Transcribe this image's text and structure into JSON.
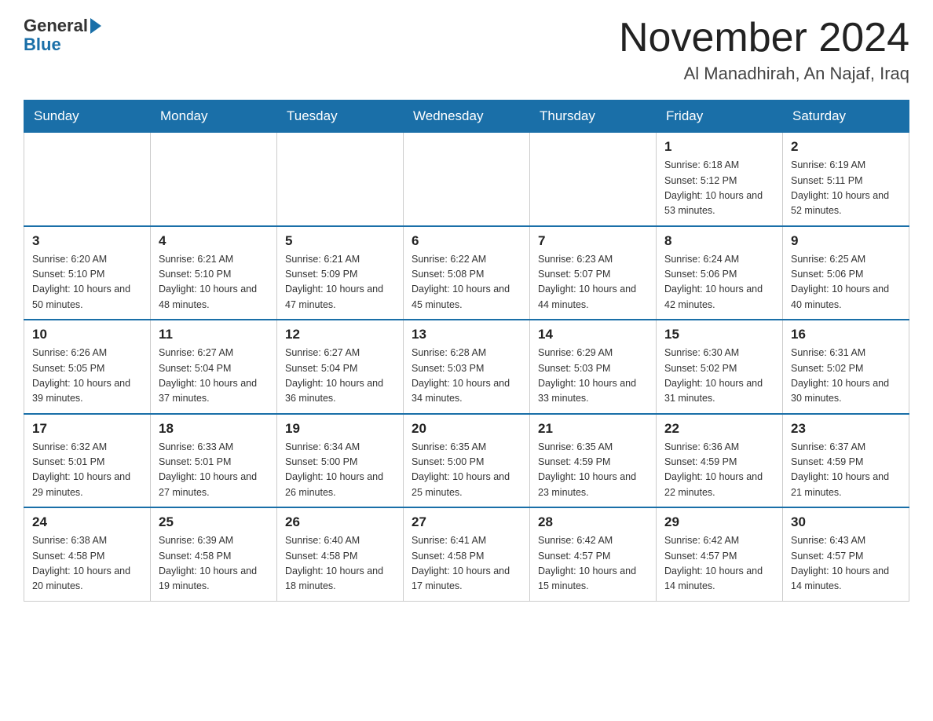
{
  "header": {
    "logo_general": "General",
    "logo_blue": "Blue",
    "title": "November 2024",
    "subtitle": "Al Manadhirah, An Najaf, Iraq"
  },
  "days_of_week": [
    "Sunday",
    "Monday",
    "Tuesday",
    "Wednesday",
    "Thursday",
    "Friday",
    "Saturday"
  ],
  "weeks": [
    [
      {
        "day": "",
        "info": ""
      },
      {
        "day": "",
        "info": ""
      },
      {
        "day": "",
        "info": ""
      },
      {
        "day": "",
        "info": ""
      },
      {
        "day": "",
        "info": ""
      },
      {
        "day": "1",
        "info": "Sunrise: 6:18 AM\nSunset: 5:12 PM\nDaylight: 10 hours and 53 minutes."
      },
      {
        "day": "2",
        "info": "Sunrise: 6:19 AM\nSunset: 5:11 PM\nDaylight: 10 hours and 52 minutes."
      }
    ],
    [
      {
        "day": "3",
        "info": "Sunrise: 6:20 AM\nSunset: 5:10 PM\nDaylight: 10 hours and 50 minutes."
      },
      {
        "day": "4",
        "info": "Sunrise: 6:21 AM\nSunset: 5:10 PM\nDaylight: 10 hours and 48 minutes."
      },
      {
        "day": "5",
        "info": "Sunrise: 6:21 AM\nSunset: 5:09 PM\nDaylight: 10 hours and 47 minutes."
      },
      {
        "day": "6",
        "info": "Sunrise: 6:22 AM\nSunset: 5:08 PM\nDaylight: 10 hours and 45 minutes."
      },
      {
        "day": "7",
        "info": "Sunrise: 6:23 AM\nSunset: 5:07 PM\nDaylight: 10 hours and 44 minutes."
      },
      {
        "day": "8",
        "info": "Sunrise: 6:24 AM\nSunset: 5:06 PM\nDaylight: 10 hours and 42 minutes."
      },
      {
        "day": "9",
        "info": "Sunrise: 6:25 AM\nSunset: 5:06 PM\nDaylight: 10 hours and 40 minutes."
      }
    ],
    [
      {
        "day": "10",
        "info": "Sunrise: 6:26 AM\nSunset: 5:05 PM\nDaylight: 10 hours and 39 minutes."
      },
      {
        "day": "11",
        "info": "Sunrise: 6:27 AM\nSunset: 5:04 PM\nDaylight: 10 hours and 37 minutes."
      },
      {
        "day": "12",
        "info": "Sunrise: 6:27 AM\nSunset: 5:04 PM\nDaylight: 10 hours and 36 minutes."
      },
      {
        "day": "13",
        "info": "Sunrise: 6:28 AM\nSunset: 5:03 PM\nDaylight: 10 hours and 34 minutes."
      },
      {
        "day": "14",
        "info": "Sunrise: 6:29 AM\nSunset: 5:03 PM\nDaylight: 10 hours and 33 minutes."
      },
      {
        "day": "15",
        "info": "Sunrise: 6:30 AM\nSunset: 5:02 PM\nDaylight: 10 hours and 31 minutes."
      },
      {
        "day": "16",
        "info": "Sunrise: 6:31 AM\nSunset: 5:02 PM\nDaylight: 10 hours and 30 minutes."
      }
    ],
    [
      {
        "day": "17",
        "info": "Sunrise: 6:32 AM\nSunset: 5:01 PM\nDaylight: 10 hours and 29 minutes."
      },
      {
        "day": "18",
        "info": "Sunrise: 6:33 AM\nSunset: 5:01 PM\nDaylight: 10 hours and 27 minutes."
      },
      {
        "day": "19",
        "info": "Sunrise: 6:34 AM\nSunset: 5:00 PM\nDaylight: 10 hours and 26 minutes."
      },
      {
        "day": "20",
        "info": "Sunrise: 6:35 AM\nSunset: 5:00 PM\nDaylight: 10 hours and 25 minutes."
      },
      {
        "day": "21",
        "info": "Sunrise: 6:35 AM\nSunset: 4:59 PM\nDaylight: 10 hours and 23 minutes."
      },
      {
        "day": "22",
        "info": "Sunrise: 6:36 AM\nSunset: 4:59 PM\nDaylight: 10 hours and 22 minutes."
      },
      {
        "day": "23",
        "info": "Sunrise: 6:37 AM\nSunset: 4:59 PM\nDaylight: 10 hours and 21 minutes."
      }
    ],
    [
      {
        "day": "24",
        "info": "Sunrise: 6:38 AM\nSunset: 4:58 PM\nDaylight: 10 hours and 20 minutes."
      },
      {
        "day": "25",
        "info": "Sunrise: 6:39 AM\nSunset: 4:58 PM\nDaylight: 10 hours and 19 minutes."
      },
      {
        "day": "26",
        "info": "Sunrise: 6:40 AM\nSunset: 4:58 PM\nDaylight: 10 hours and 18 minutes."
      },
      {
        "day": "27",
        "info": "Sunrise: 6:41 AM\nSunset: 4:58 PM\nDaylight: 10 hours and 17 minutes."
      },
      {
        "day": "28",
        "info": "Sunrise: 6:42 AM\nSunset: 4:57 PM\nDaylight: 10 hours and 15 minutes."
      },
      {
        "day": "29",
        "info": "Sunrise: 6:42 AM\nSunset: 4:57 PM\nDaylight: 10 hours and 14 minutes."
      },
      {
        "day": "30",
        "info": "Sunrise: 6:43 AM\nSunset: 4:57 PM\nDaylight: 10 hours and 14 minutes."
      }
    ]
  ]
}
